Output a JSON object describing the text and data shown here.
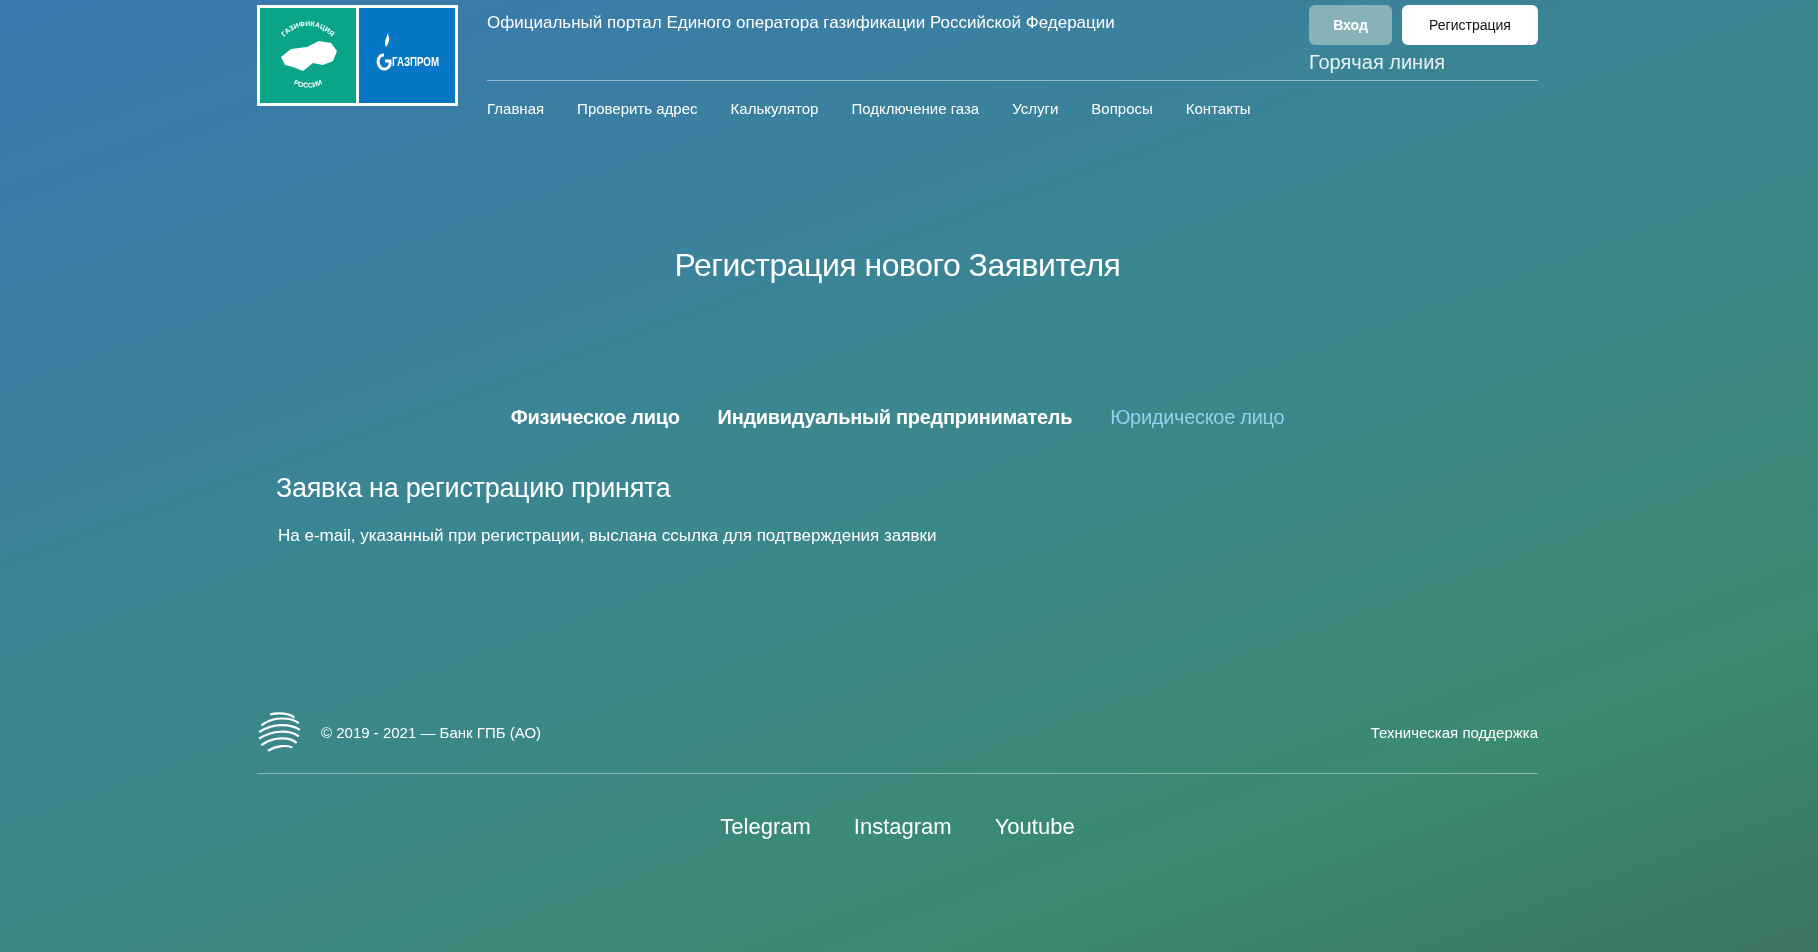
{
  "header": {
    "logo": {
      "region_text_top": "ГАЗИФИКАЦИЯ",
      "region_text_bottom": "РОССИИ",
      "brand": "ГАЗПРОМ"
    },
    "portal_title": "Официальный портал Единого оператора газификации Российской Федерации",
    "buttons": [
      {
        "label": "Вход",
        "kind": "secondary"
      },
      {
        "label": "Регистрация",
        "kind": "primary"
      }
    ],
    "hotline": "Горячая линия",
    "nav": [
      "Главная",
      "Проверить адрес",
      "Калькулятор",
      "Подключение газа",
      "Услуги",
      "Вопросы",
      "Контакты"
    ]
  },
  "page_title": "Регистрация нового Заявителя",
  "tabs": [
    {
      "label": "Физическое лицо",
      "selected": false
    },
    {
      "label": "Индивидуальный предприниматель",
      "selected": false
    },
    {
      "label": "Юридическое лицо",
      "selected": true
    }
  ],
  "message": {
    "title": "Заявка на регистрацию принята",
    "text": "На e-mail, указанный при регистрации, выслана ссылка для подтверждения заявки"
  },
  "footer": {
    "copyright": "© 2019 - 2021 — Банк ГПБ (АО)",
    "support": "Техническая поддержка",
    "social": [
      "Telegram",
      "Instagram",
      "Youtube"
    ]
  }
}
